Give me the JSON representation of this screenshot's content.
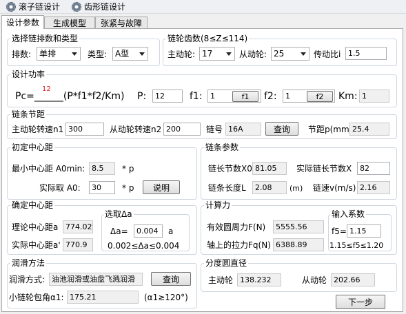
{
  "toolbar": {
    "roller": "滚子链设计",
    "tooth": "齿形链设计"
  },
  "tabs": [
    "设计参数",
    "生成模型",
    "张紧与故障"
  ],
  "chain_type": {
    "title": "选择链排数和类型",
    "rows_label": "排数:",
    "rows_value": "单排",
    "type_label": "类型:",
    "type_value": "A型"
  },
  "teeth": {
    "title": "链轮齿数(8≤Z≤114)",
    "driver_label": "主动轮:",
    "driver_value": "17",
    "driven_label": "从动轮:",
    "driven_value": "25",
    "ratio_label": "传动比i",
    "ratio_value": "1.5"
  },
  "power": {
    "title": "设计功率",
    "marker": "12",
    "formula": "Pc=______(P*f1*f2/Km)",
    "p_label": "P:",
    "p_value": "12",
    "f1_label": "f1:",
    "f1_value": "1",
    "f1_btn": "f1",
    "f2_label": "f2:",
    "f2_value": "1",
    "f2_btn": "f2",
    "km_label": "Km:",
    "km_value": "1"
  },
  "pitch": {
    "title": "链条节距",
    "n1_label": "主动轮转速n1",
    "n1_value": "300",
    "n2_label": "从动轮转速n2",
    "n2_value": "200",
    "chain_no_label": "链号",
    "chain_no_value": "16A",
    "query_btn": "查询",
    "pitch_label": "节距p(mm)",
    "pitch_value": "25.4"
  },
  "center_init": {
    "title": "初定中心距",
    "min_label": "最小中心距 A0min:",
    "min_value": "8.5",
    "min_unit": "* p",
    "actual_label": "实际取 A0:",
    "actual_value": "30",
    "actual_unit": "* p",
    "explain_btn": "说明"
  },
  "chain_params": {
    "title": "链条参数",
    "x0_label": "链长节数X0",
    "x0_value": "81.05",
    "x_label": "实际链长节数X",
    "x_value": "82",
    "l_label": "链条长度L",
    "l_value": "2.08",
    "l_unit": "(m)",
    "v_label": "链速v(m/s)",
    "v_value": "2.16"
  },
  "center_final": {
    "title": "确定中心距",
    "theory_label": "理论中心距a",
    "theory_value": "774.02",
    "actual_label": "实际中心距a'",
    "actual_value": "770.9",
    "delta_title": "选取Δa",
    "delta_label": "Δa=",
    "delta_value": "0.004",
    "delta_unit": "a",
    "delta_range": "0.002≤Δa≤0.004"
  },
  "calc": {
    "title": "计算力",
    "f_label": "有效圆周力F(N)",
    "f_value": "5555.56",
    "fq_label": "轴上的拉力Fq(N)",
    "fq_value": "6388.89",
    "coef_title": "输入系数",
    "f5_label": "f5=",
    "f5_value": "1.15",
    "f5_range": "1.15≤f5≤1.20"
  },
  "lubrication": {
    "title": "润滑方法",
    "method_label": "润滑方式:",
    "method_value": "油池润滑或油盘飞溅润滑",
    "query_btn": "查询",
    "wrap_label": "小链轮包角α1:",
    "wrap_value": "175.21",
    "wrap_note": "(α1≥120°)"
  },
  "pitch_circle": {
    "title": "分度圆直径",
    "driver_label": "主动轮",
    "driver_value": "138.232",
    "driven_label": "从动轮",
    "driven_value": "202.66"
  },
  "next_btn": "下一步"
}
